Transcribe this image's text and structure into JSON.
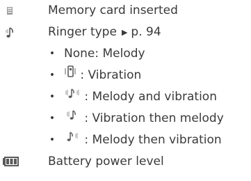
{
  "items": [
    {
      "icon": "memory-card-icon",
      "label": "Memory card inserted"
    },
    {
      "icon": "ringer-type-icon",
      "label": "Ringer type",
      "arrow": "▶",
      "page_ref": "p. 94"
    },
    {
      "icon": "battery-icon",
      "label": "Battery power level"
    }
  ],
  "ringer_options": [
    {
      "icon": "",
      "text": "None: Melody"
    },
    {
      "icon": "vibration-icon",
      "text": ": Vibration"
    },
    {
      "icon": "melody-and-vibration-icon",
      "text": ": Melody and vibration"
    },
    {
      "icon": "vibration-then-melody-icon",
      "text": ": Vibration then melody"
    },
    {
      "icon": "melody-then-vibration-icon",
      "text": ": Melody then vibration"
    }
  ],
  "colors": {
    "text": "#3a3a3a",
    "icon": "#6b6b6b"
  }
}
